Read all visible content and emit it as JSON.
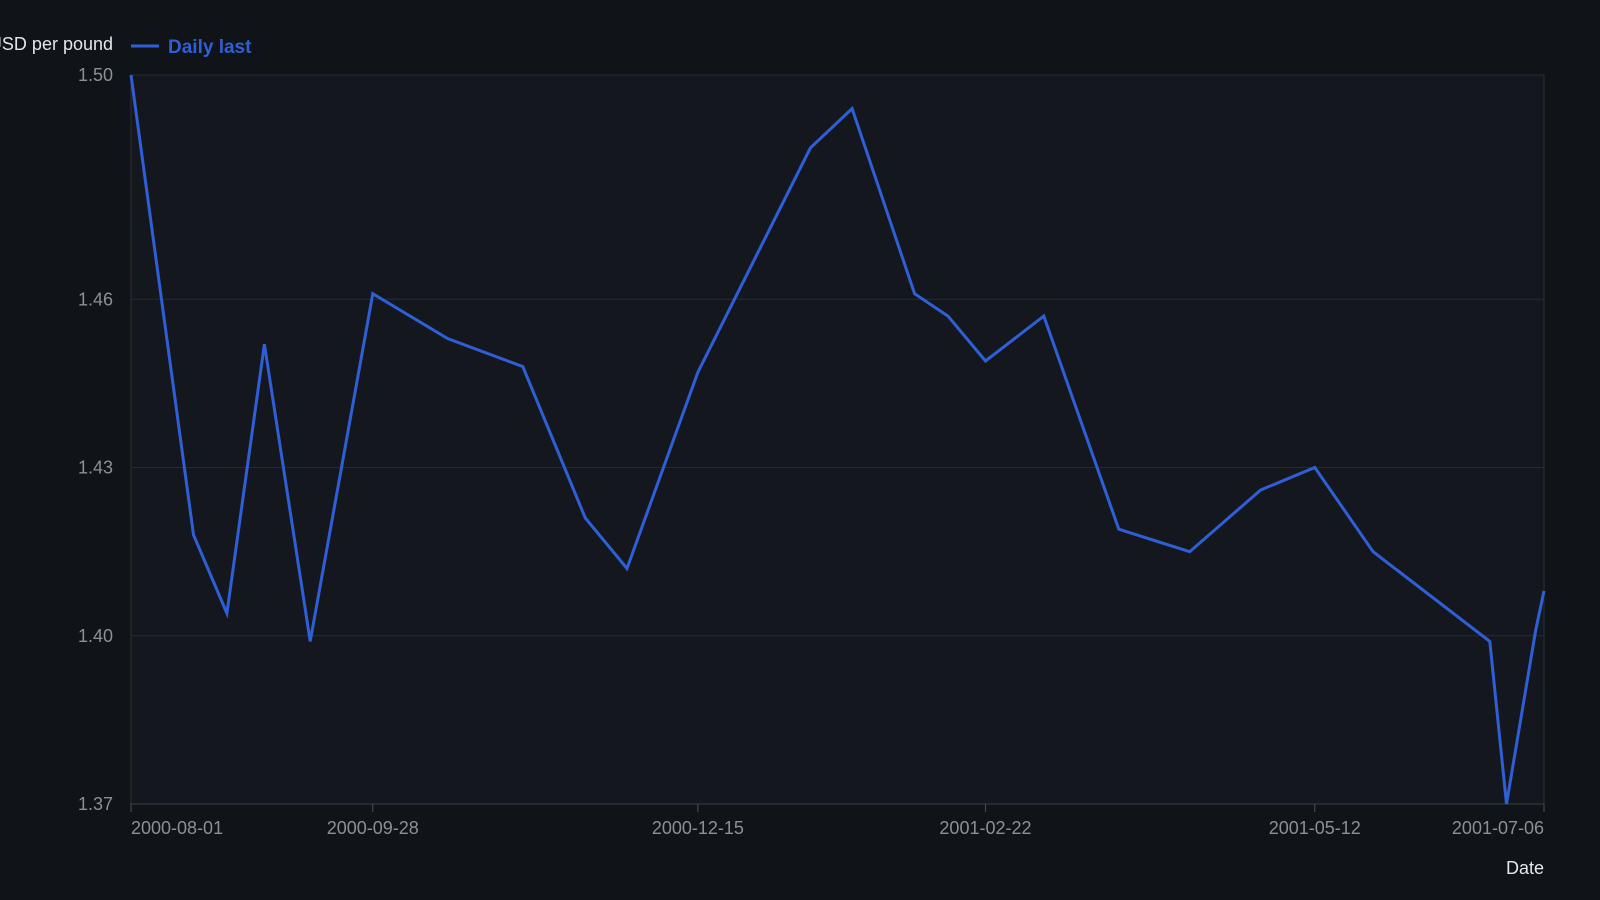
{
  "chart_data": {
    "type": "line",
    "title": "",
    "ylabel": "USD per pound",
    "xlabel": "Date",
    "ylim": [
      1.37,
      1.5
    ],
    "yticks": [
      1.37,
      1.4,
      1.43,
      1.46,
      1.5
    ],
    "ytick_labels": [
      "1.37",
      "1.40",
      "1.43",
      "1.46",
      "1.50"
    ],
    "xlim": [
      "2000-08-01",
      "2001-07-06"
    ],
    "xticks": [
      "2000-08-01",
      "2000-09-28",
      "2000-12-15",
      "2001-02-22",
      "2001-05-12",
      "2001-07-06"
    ],
    "grid": true,
    "legend_position": "top-left",
    "series": [
      {
        "name": "Daily last",
        "color": "#2f5fd6",
        "points": [
          {
            "x": "2000-08-01",
            "y": 1.5
          },
          {
            "x": "2000-08-16",
            "y": 1.418
          },
          {
            "x": "2000-08-24",
            "y": 1.404
          },
          {
            "x": "2000-09-02",
            "y": 1.452
          },
          {
            "x": "2000-09-13",
            "y": 1.399
          },
          {
            "x": "2000-09-28",
            "y": 1.461
          },
          {
            "x": "2000-10-16",
            "y": 1.453
          },
          {
            "x": "2000-11-03",
            "y": 1.448
          },
          {
            "x": "2000-11-18",
            "y": 1.421
          },
          {
            "x": "2000-11-28",
            "y": 1.412
          },
          {
            "x": "2000-12-15",
            "y": 1.447
          },
          {
            "x": "2001-01-11",
            "y": 1.487
          },
          {
            "x": "2001-01-21",
            "y": 1.494
          },
          {
            "x": "2001-02-05",
            "y": 1.461
          },
          {
            "x": "2001-02-13",
            "y": 1.457
          },
          {
            "x": "2001-02-22",
            "y": 1.449
          },
          {
            "x": "2001-03-08",
            "y": 1.457
          },
          {
            "x": "2001-03-26",
            "y": 1.419
          },
          {
            "x": "2001-04-12",
            "y": 1.415
          },
          {
            "x": "2001-04-29",
            "y": 1.426
          },
          {
            "x": "2001-05-12",
            "y": 1.43
          },
          {
            "x": "2001-05-26",
            "y": 1.415
          },
          {
            "x": "2001-06-23",
            "y": 1.399
          },
          {
            "x": "2001-06-27",
            "y": 1.37
          },
          {
            "x": "2001-07-04",
            "y": 1.401
          },
          {
            "x": "2001-07-06",
            "y": 1.408
          }
        ]
      }
    ]
  }
}
